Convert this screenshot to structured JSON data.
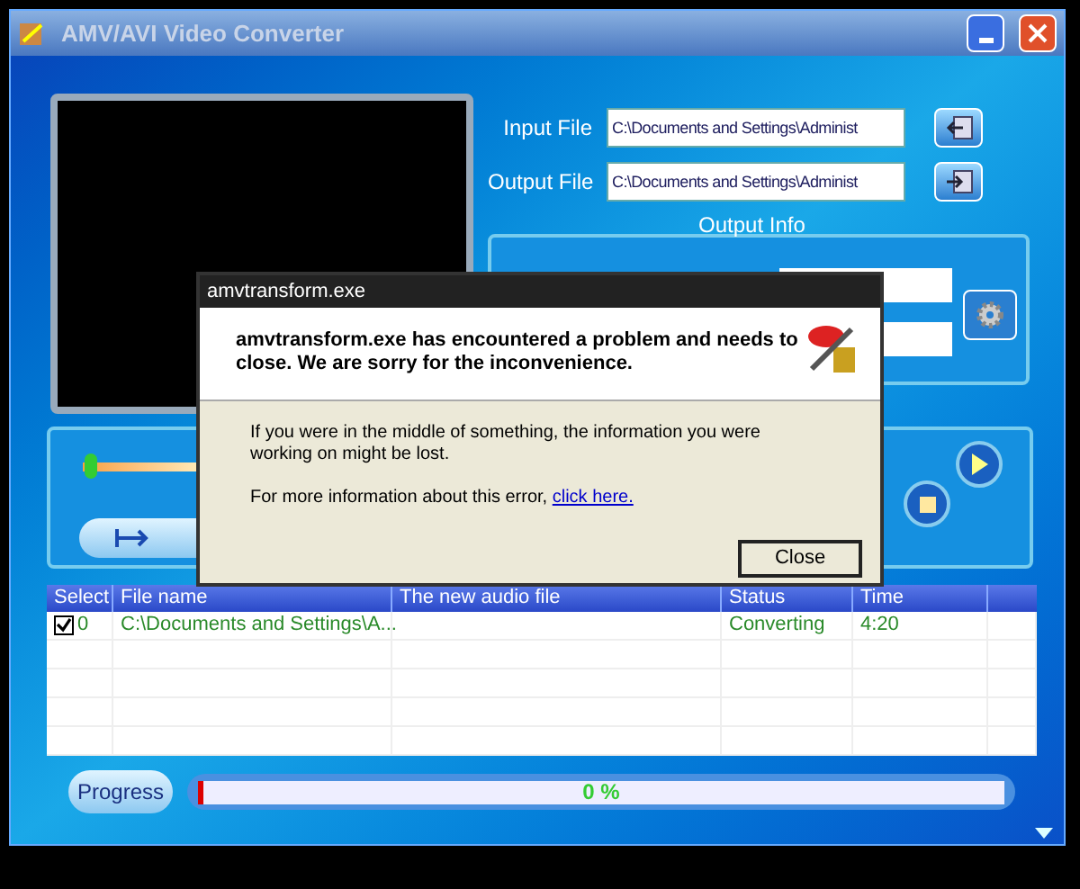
{
  "window": {
    "title": "AMV/AVI Video Converter"
  },
  "input_file": {
    "label": "Input File",
    "value": "C:\\Documents and Settings\\Administ"
  },
  "output_file": {
    "label": "Output File",
    "value": "C:\\Documents and Settings\\Administ"
  },
  "output_info": {
    "title": "Output Info"
  },
  "seek_slider": {
    "level": 0.02
  },
  "table": {
    "columns": [
      "Select",
      "File name",
      "The new audio file",
      "Status",
      "Time"
    ],
    "rows": [
      {
        "checked": true,
        "index": "0",
        "file_name": "C:\\Documents and Settings\\A...",
        "audio_file": "",
        "status": "Converting",
        "time": "4:20"
      }
    ]
  },
  "progress": {
    "button": "Progress",
    "level": 0,
    "reading": "0 %"
  },
  "dialog": {
    "title": "amvtransform.exe",
    "heading": "amvtransform.exe has encountered a problem and needs to close.  We are sorry for the inconvenience.",
    "message": "If you were in the middle of something, the information you were working on might be lost.",
    "more_info": "For more information about this error,",
    "link": "click here.",
    "button": "Close"
  }
}
